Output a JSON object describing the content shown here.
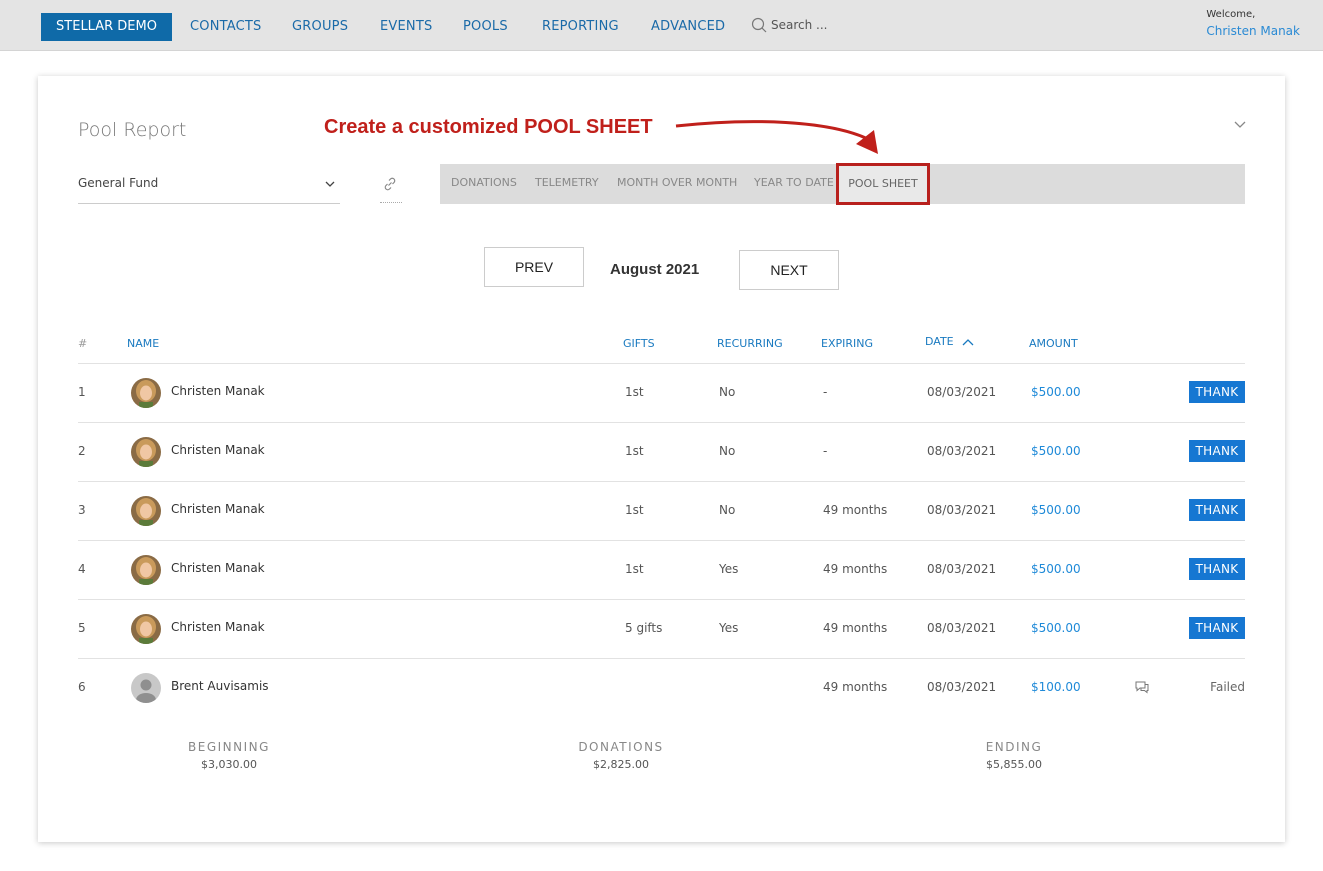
{
  "nav": {
    "brand": "STELLAR DEMO",
    "items": [
      "CONTACTS",
      "GROUPS",
      "EVENTS",
      "POOLS",
      "REPORTING",
      "ADVANCED"
    ],
    "search_placeholder": "Search ...",
    "welcome_label": "Welcome,",
    "user_name": "Christen Manak"
  },
  "report": {
    "title": "Pool Report",
    "annotation": "Create a customized POOL SHEET",
    "fund": "General Fund",
    "tabs": [
      "DONATIONS",
      "TELEMETRY",
      "MONTH OVER MONTH",
      "YEAR TO DATE",
      "POOL SHEET"
    ],
    "active_tab": "POOL SHEET",
    "prev_label": "PREV",
    "next_label": "NEXT",
    "month": "August 2021"
  },
  "table": {
    "headers": {
      "num": "#",
      "name": "NAME",
      "gifts": "GIFTS",
      "recurring": "RECURRING",
      "expiring": "EXPIRING",
      "date": "DATE",
      "amount": "AMOUNT"
    },
    "sort_column": "DATE",
    "sort_direction": "ascending",
    "rows": [
      {
        "num": "1",
        "name": "Christen Manak",
        "gifts": "1st",
        "recurring": "No",
        "expiring": "-",
        "date": "08/03/2021",
        "amount": "$500.00",
        "action": "THANK",
        "avatar": "photo"
      },
      {
        "num": "2",
        "name": "Christen Manak",
        "gifts": "1st",
        "recurring": "No",
        "expiring": "-",
        "date": "08/03/2021",
        "amount": "$500.00",
        "action": "THANK",
        "avatar": "photo"
      },
      {
        "num": "3",
        "name": "Christen Manak",
        "gifts": "1st",
        "recurring": "No",
        "expiring": "49 months",
        "date": "08/03/2021",
        "amount": "$500.00",
        "action": "THANK",
        "avatar": "photo"
      },
      {
        "num": "4",
        "name": "Christen Manak",
        "gifts": "1st",
        "recurring": "Yes",
        "expiring": "49 months",
        "date": "08/03/2021",
        "amount": "$500.00",
        "action": "THANK",
        "avatar": "photo"
      },
      {
        "num": "5",
        "name": "Christen Manak",
        "gifts": "5 gifts",
        "recurring": "Yes",
        "expiring": "49 months",
        "date": "08/03/2021",
        "amount": "$500.00",
        "action": "THANK",
        "avatar": "photo"
      },
      {
        "num": "6",
        "name": "Brent Auvisamis",
        "gifts": "",
        "recurring": "",
        "expiring": "49 months",
        "date": "08/03/2021",
        "amount": "$100.00",
        "status": "Failed",
        "avatar": "placeholder"
      }
    ]
  },
  "summary": {
    "beginning_label": "BEGINNING",
    "beginning_value": "$3,030.00",
    "donations_label": "DONATIONS",
    "donations_value": "$2,825.00",
    "ending_label": "ENDING",
    "ending_value": "$5,855.00"
  },
  "colors": {
    "brand": "#0f6aa8",
    "link": "#1a7ac0",
    "thank_button": "#1677d2",
    "annotation": "#c0201b"
  }
}
